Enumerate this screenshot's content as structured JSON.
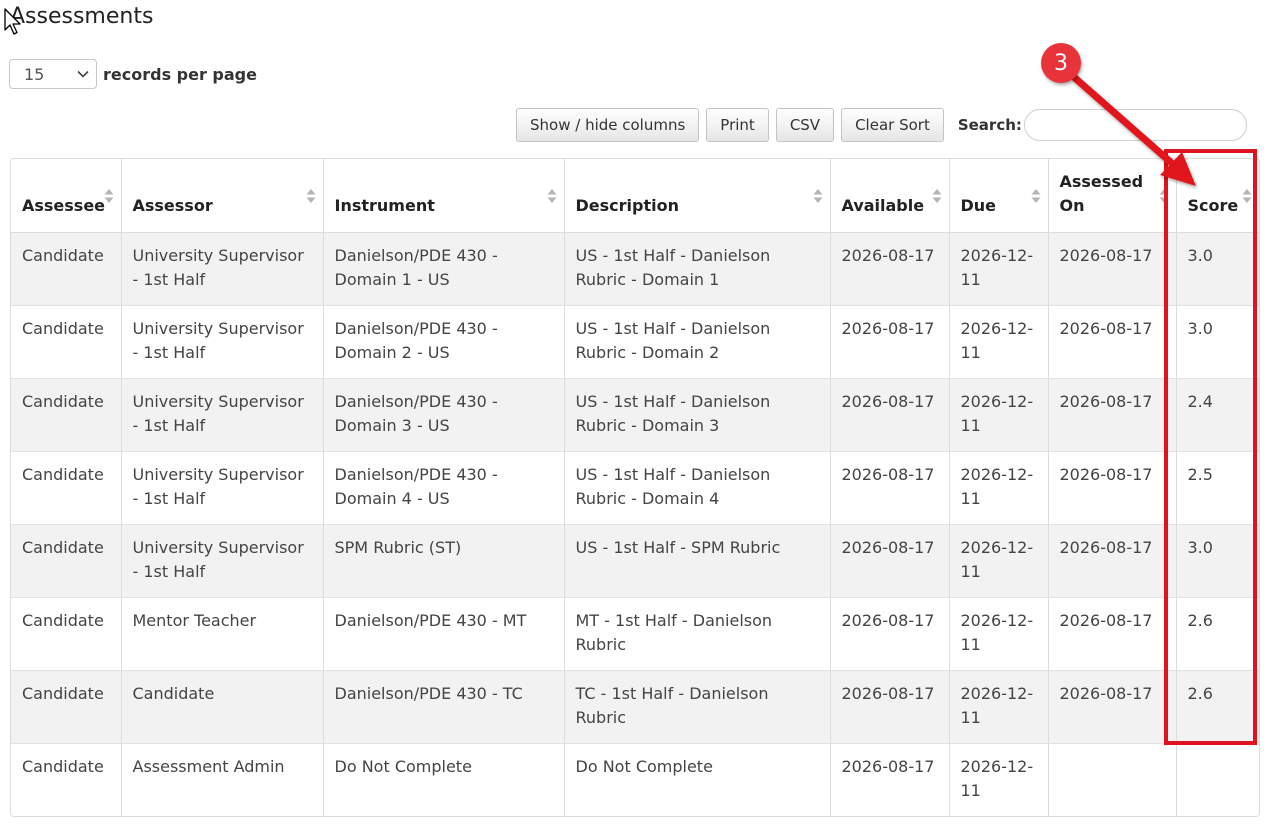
{
  "page": {
    "title": "Assessments"
  },
  "length_menu": {
    "selected": "15",
    "label": "records per page",
    "icon": "chevron-down-icon"
  },
  "toolbar": {
    "show_hide_label": "Show / hide columns",
    "print_label": "Print",
    "csv_label": "CSV",
    "clear_sort_label": "Clear Sort",
    "search_label": "Search:",
    "search_value": ""
  },
  "table": {
    "columns": [
      {
        "label": "Assessee"
      },
      {
        "label": "Assessor"
      },
      {
        "label": "Instrument"
      },
      {
        "label": "Description"
      },
      {
        "label": "Available"
      },
      {
        "label": "Due"
      },
      {
        "label": "Assessed On"
      },
      {
        "label": "Score"
      }
    ],
    "rows": [
      {
        "assessee": "Candidate",
        "assessor": "University Supervisor - 1st Half",
        "instrument": "Danielson/PDE 430 - Domain 1 - US",
        "description": "US - 1st Half - Danielson Rubric - Domain 1",
        "available": "2026-08-17",
        "due": "2026-12-11",
        "assessed_on": "2026-08-17",
        "score": "3.0"
      },
      {
        "assessee": "Candidate",
        "assessor": "University Supervisor - 1st Half",
        "instrument": "Danielson/PDE 430 - Domain 2 - US",
        "description": "US - 1st Half - Danielson Rubric - Domain 2",
        "available": "2026-08-17",
        "due": "2026-12-11",
        "assessed_on": "2026-08-17",
        "score": "3.0"
      },
      {
        "assessee": "Candidate",
        "assessor": "University Supervisor - 1st Half",
        "instrument": "Danielson/PDE 430 - Domain 3 - US",
        "description": "US - 1st Half - Danielson Rubric - Domain 3",
        "available": "2026-08-17",
        "due": "2026-12-11",
        "assessed_on": "2026-08-17",
        "score": "2.4"
      },
      {
        "assessee": "Candidate",
        "assessor": "University Supervisor - 1st Half",
        "instrument": "Danielson/PDE 430 - Domain 4 - US",
        "description": "US - 1st Half - Danielson Rubric - Domain 4",
        "available": "2026-08-17",
        "due": "2026-12-11",
        "assessed_on": "2026-08-17",
        "score": "2.5"
      },
      {
        "assessee": "Candidate",
        "assessor": "University Supervisor - 1st Half",
        "instrument": "SPM Rubric (ST)",
        "description": "US - 1st Half - SPM Rubric",
        "available": "2026-08-17",
        "due": "2026-12-11",
        "assessed_on": "2026-08-17",
        "score": "3.0"
      },
      {
        "assessee": "Candidate",
        "assessor": "Mentor Teacher",
        "instrument": "Danielson/PDE 430 - MT",
        "description": "MT - 1st Half - Danielson Rubric",
        "available": "2026-08-17",
        "due": "2026-12-11",
        "assessed_on": "2026-08-17",
        "score": "2.6"
      },
      {
        "assessee": "Candidate",
        "assessor": "Candidate",
        "instrument": "Danielson/PDE 430 - TC",
        "description": "TC - 1st Half - Danielson Rubric",
        "available": "2026-08-17",
        "due": "2026-12-11",
        "assessed_on": "2026-08-17",
        "score": "2.6"
      },
      {
        "assessee": "Candidate",
        "assessor": "Assessment Admin",
        "instrument": "Do Not Complete",
        "description": "Do Not Complete",
        "available": "2026-08-17",
        "due": "2026-12-11",
        "assessed_on": "",
        "score": ""
      }
    ]
  },
  "annotation": {
    "step_number": "3",
    "color": "#e0141e"
  }
}
